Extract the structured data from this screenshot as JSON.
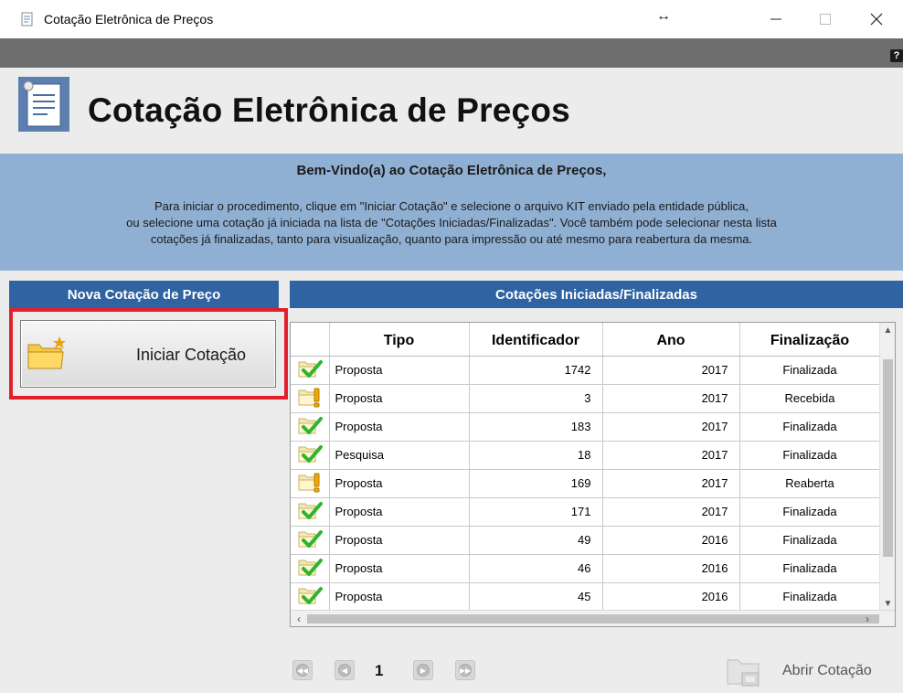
{
  "window": {
    "title": "Cotação Eletrônica de Preços",
    "resize_glyph": "↔",
    "controls": {
      "minimize": "—",
      "maximize": "☐",
      "close": "✕"
    },
    "help_label": "?"
  },
  "header": {
    "title": "Cotação Eletrônica de Preços",
    "icon": "document-icon"
  },
  "info": {
    "welcome": "Bem-Vindo(a) ao Cotação Eletrônica de Preços,",
    "line1": "Para iniciar o procedimento, clique em \"Iniciar Cotação\" e selecione o arquivo KIT enviado pela entidade pública,",
    "line2": "ou selecione uma cotação já iniciada na lista de \"Cotações Iniciadas/Finalizadas\". Você também pode selecionar nesta lista",
    "line3": "cotações já finalizadas, tanto para visualização, quanto para impressão ou até mesmo para reabertura da mesma."
  },
  "left_panel": {
    "heading": "Nova Cotação de Preço",
    "start_button": "Iniciar Cotação"
  },
  "right_panel": {
    "heading": "Cotações Iniciadas/Finalizadas",
    "columns": [
      "Tipo",
      "Identificador",
      "Ano",
      "Finalização"
    ],
    "rows": [
      {
        "status": "check",
        "tipo": "Proposta",
        "id": "1742",
        "ano": "2017",
        "fin": "Finalizada"
      },
      {
        "status": "warning",
        "tipo": "Proposta",
        "id": "3",
        "ano": "2017",
        "fin": "Recebida"
      },
      {
        "status": "check",
        "tipo": "Proposta",
        "id": "183",
        "ano": "2017",
        "fin": "Finalizada"
      },
      {
        "status": "check",
        "tipo": "Pesquisa",
        "id": "18",
        "ano": "2017",
        "fin": "Finalizada"
      },
      {
        "status": "warning",
        "tipo": "Proposta",
        "id": "169",
        "ano": "2017",
        "fin": "Reaberta"
      },
      {
        "status": "check",
        "tipo": "Proposta",
        "id": "171",
        "ano": "2017",
        "fin": "Finalizada"
      },
      {
        "status": "check",
        "tipo": "Proposta",
        "id": "49",
        "ano": "2016",
        "fin": "Finalizada"
      },
      {
        "status": "check",
        "tipo": "Proposta",
        "id": "46",
        "ano": "2016",
        "fin": "Finalizada"
      },
      {
        "status": "check",
        "tipo": "Proposta",
        "id": "45",
        "ano": "2016",
        "fin": "Finalizada"
      }
    ]
  },
  "pager": {
    "page": "1"
  },
  "open_button": {
    "label": "Abrir Cotação"
  },
  "colors": {
    "accent": "#2f63a2",
    "banner": "#8fb0d2",
    "highlight": "#e0202a",
    "check": "#2db52d",
    "warning": "#f0a800"
  }
}
